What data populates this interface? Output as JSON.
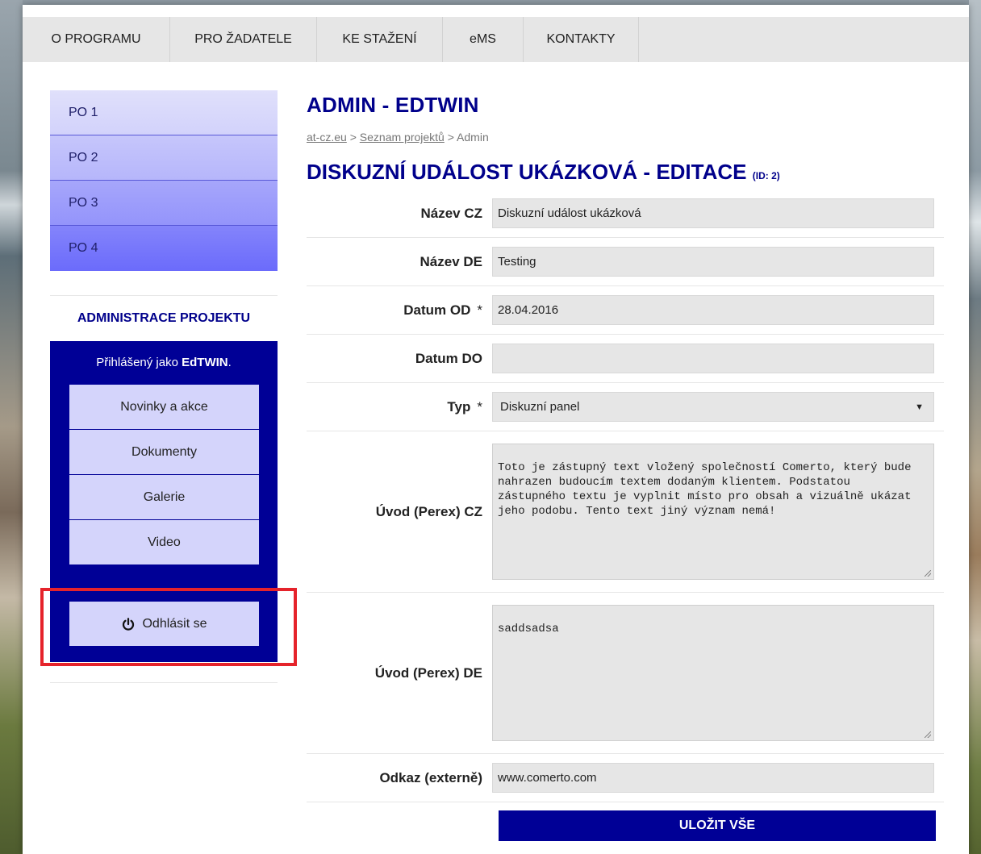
{
  "nav": {
    "items": [
      {
        "label": "O PROGRAMU"
      },
      {
        "label": "PRO ŽADATELE"
      },
      {
        "label": "KE STAŽENÍ"
      },
      {
        "label": "eMS"
      },
      {
        "label": "KONTAKTY"
      }
    ]
  },
  "sidebar": {
    "po_items": [
      {
        "label": "PO 1"
      },
      {
        "label": "PO 2"
      },
      {
        "label": "PO 3"
      },
      {
        "label": "PO 4"
      }
    ],
    "admin_title": "ADMINISTRACE PROJEKTU",
    "logged_prefix": "Přihlášený jako",
    "logged_user": "EdTWIN",
    "logged_suffix": ".",
    "links": [
      {
        "label": "Novinky a akce"
      },
      {
        "label": "Dokumenty"
      },
      {
        "label": "Galerie"
      },
      {
        "label": "Video"
      }
    ],
    "logout_label": "Odhlásit se"
  },
  "main": {
    "title": "ADMIN - EDTWIN",
    "breadcrumb": {
      "home": "at-cz.eu",
      "sep1": ">",
      "projects": "Seznam projektů",
      "sep2": ">",
      "current": "Admin"
    },
    "subtitle": "DISKUZNÍ UDÁLOST UKÁZKOVÁ - EDITACE",
    "subtitle_id": "(ID: 2)"
  },
  "form": {
    "name_cz_label": "Název CZ",
    "name_cz_value": "Diskuzní událost ukázková",
    "name_de_label": "Název DE",
    "name_de_value": "Testing",
    "date_from_label": "Datum OD",
    "date_from_value": "28.04.2016",
    "date_to_label": "Datum DO",
    "date_to_value": "",
    "type_label": "Typ",
    "type_value": "Diskuzní panel",
    "required_mark": "*",
    "perex_cz_label": "Úvod (Perex) CZ",
    "perex_cz_value": "Toto je zástupný text vložený společností Comerto, který bude\nnahrazen budoucím textem dodaným klientem. Podstatou\nzástupného textu je vyplnit místo pro obsah a vizuálně ukázat\njeho podobu. Tento text jiný význam nemá!",
    "perex_de_label": "Úvod (Perex) DE",
    "perex_de_value": "saddsadsa",
    "link_label": "Odkaz (externě)",
    "link_value": "www.comerto.com",
    "save_label": "ULOŽIT VŠE"
  },
  "colors": {
    "brand_navy": "#000096",
    "heading_blue": "#00008b",
    "highlight_red": "#e5232b"
  }
}
